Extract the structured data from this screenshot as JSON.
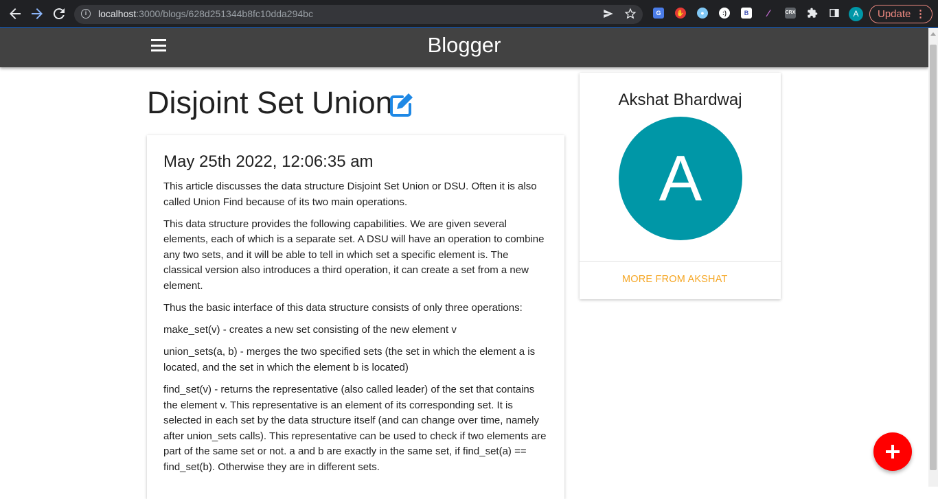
{
  "browser": {
    "url_host": "localhost",
    "url_path": ":3000/blogs/628d251344b8fc10dda294bc",
    "update_label": "Update",
    "profile_initial": "A",
    "extensions": [
      "google-translate-icon",
      "adblock-icon",
      "owl-icon",
      "face-icon",
      "bold-icon",
      "feather-icon",
      "crx-icon",
      "puzzle-icon",
      "sidepanel-icon"
    ]
  },
  "appbar": {
    "title": "Blogger"
  },
  "post": {
    "title": "Disjoint Set Union",
    "date": "May 25th 2022, 12:06:35 am",
    "paragraphs": [
      "This article discusses the data structure  Disjoint Set Union or DSU. Often it is also called Union Find because of its two main operations.",
      "This data structure provides the following capabilities. We are given several elements, each of which is a separate set. A DSU will have an operation to combine any two sets, and it will be able to tell in which set a specific element is. The classical version also introduces a third operation, it can create a set from a new element.",
      "Thus the basic interface of this data structure consists of only three operations:",
      "make_set(v) - creates a new set consisting of the new element v",
      "union_sets(a, b) - merges the two specified sets (the set in which the element a is located, and the set in which the element b is located)",
      "find_set(v) - returns the representative (also called leader) of the set that contains the element v. This representative is an element of its corresponding set. It is selected in each set by the data structure itself (and can change over time, namely after union_sets calls). This representative can be used to check if two elements are part of the same set or not. a and b are exactly in the same set, if find_set(a) == find_set(b). Otherwise they are in different sets."
    ]
  },
  "author": {
    "name": "Akshat Bhardwaj",
    "initial": "A",
    "more_label": "MORE FROM AKSHAT"
  },
  "colors": {
    "appbar": "#424242",
    "avatar": "#0097a7",
    "accent_link": "#f5a623",
    "fab": "#ff0000",
    "edit_icon": "#1e88e5"
  }
}
